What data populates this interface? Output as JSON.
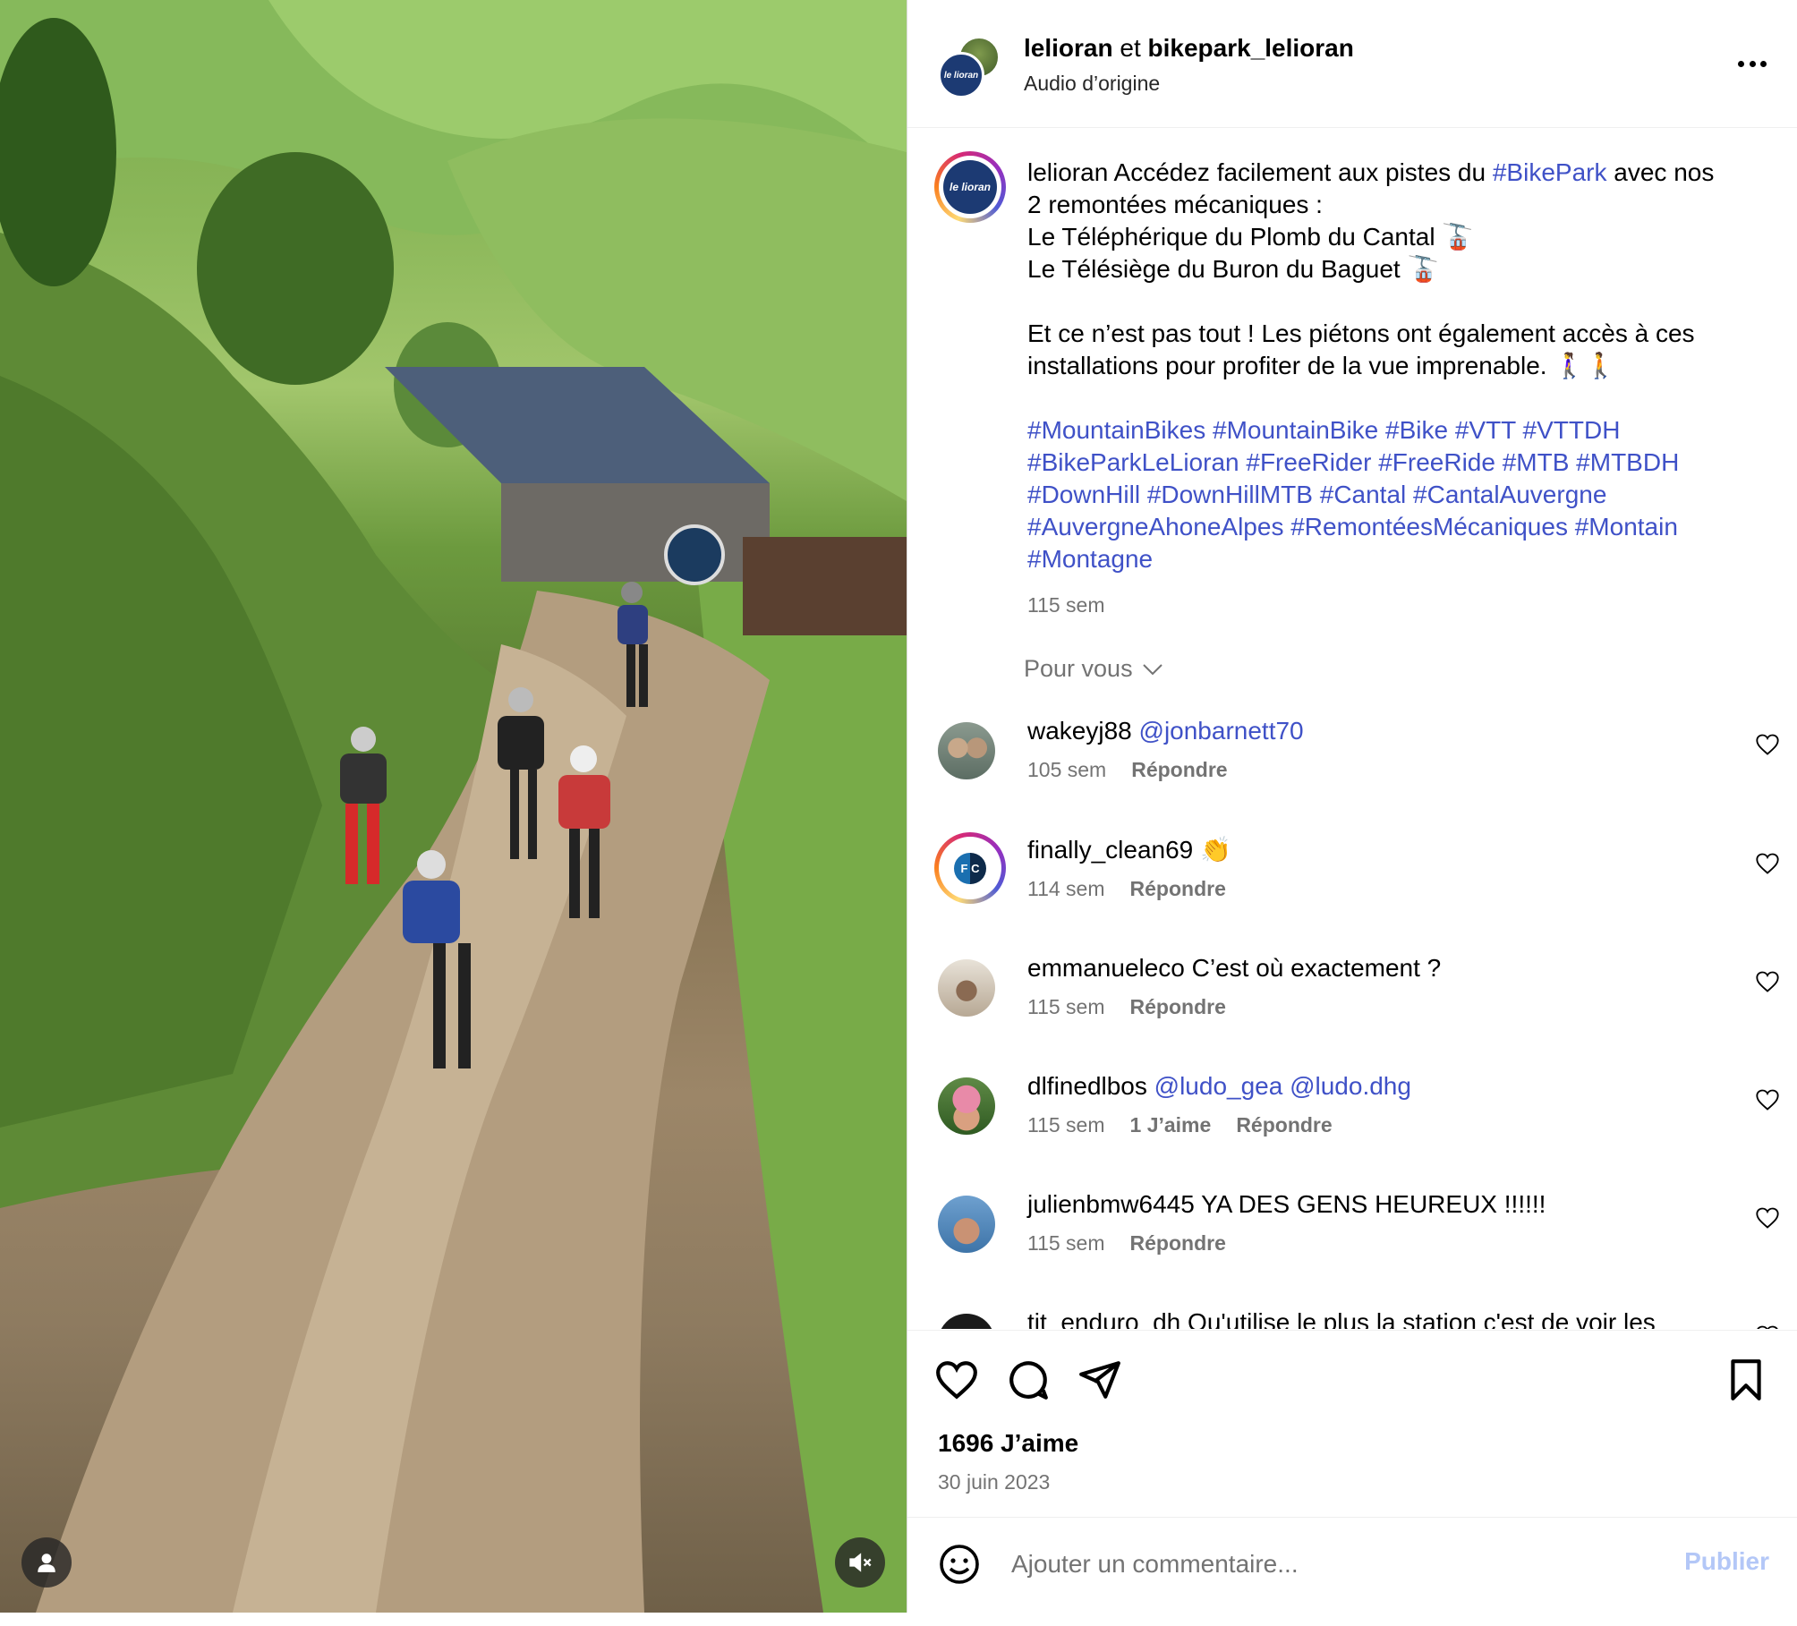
{
  "post": {
    "header": {
      "author": "lelioran",
      "conjunction": "et",
      "coauthor": "bikepark_lelioran",
      "audio": "Audio d’origine",
      "avatar_text": "le lioran"
    },
    "caption": {
      "username": "lelioran",
      "line1_text": "Accédez facilement aux pistes du",
      "line1_tag": "#BikePark",
      "line1_end": "avec nos",
      "line2": "2 remontées mécaniques :",
      "line3": "Le Téléphérique du Plomb du Cantal 🚡",
      "line4": "Le Télésiège du Buron du Baguet 🚡",
      "line5": "Et ce n’est pas tout ! Les piétons ont également accès à ces",
      "line6": "installations pour profiter de la vue imprenable. 🚶‍♀️🚶",
      "hashtag_line1": "#MountainBikes #MountainBike #Bike #VTT #VTTDH",
      "hashtag_line2": "#BikeParkLeLioran #FreeRider #FreeRide #MTB #MTBDH",
      "hashtag_line3": "#DownHill #DownHillMTB #Cantal #CantalAuvergne",
      "hashtag_line4": "#AuvergneAhoneAlpes #RemontéesMécaniques #Montain",
      "hashtag_line5": "#Montagne",
      "time": "115 sem"
    },
    "filter_label": "Pour vous",
    "comments": [
      {
        "user": "wakeyj88",
        "text": "",
        "mention": "@jonbarnett70",
        "time": "105 sem",
        "likes": "",
        "reply": "Répondre"
      },
      {
        "user": "finally_clean69",
        "text": "👏",
        "mention": "",
        "time": "114 sem",
        "likes": "",
        "reply": "Répondre",
        "avatar_text": "F C"
      },
      {
        "user": "emmanueleco",
        "text": "C’est où exactement ?",
        "mention": "",
        "time": "115 sem",
        "likes": "",
        "reply": "Répondre"
      },
      {
        "user": "dlfinedlbos",
        "text": "",
        "mention": "@ludo_gea @ludo.dhg",
        "time": "115 sem",
        "likes": "1 J’aime",
        "reply": "Répondre"
      },
      {
        "user": "julienbmw6445",
        "text": "YA DES GENS HEUREUX !!!!!!",
        "mention": "",
        "time": "115 sem",
        "likes": "",
        "reply": "Répondre"
      },
      {
        "user": "tit_enduro_dh",
        "text": "Qu'utilise le plus la station c'est de voir les",
        "mention": "",
        "time": "",
        "likes": "",
        "reply": ""
      }
    ],
    "likes_count": "1696 J’aime",
    "date": "30 juin 2023",
    "comment_placeholder": "Ajouter un commentaire...",
    "publish_label": "Publier",
    "colors": {
      "link": "#3f51c7",
      "muted": "#737373",
      "publish": "#b3c7f7"
    }
  },
  "icons": [
    "user-tag-icon",
    "mute-icon",
    "more-options-icon",
    "chevron-down-icon",
    "heart-icon",
    "comment-icon",
    "share-icon",
    "bookmark-icon",
    "emoji-icon"
  ]
}
